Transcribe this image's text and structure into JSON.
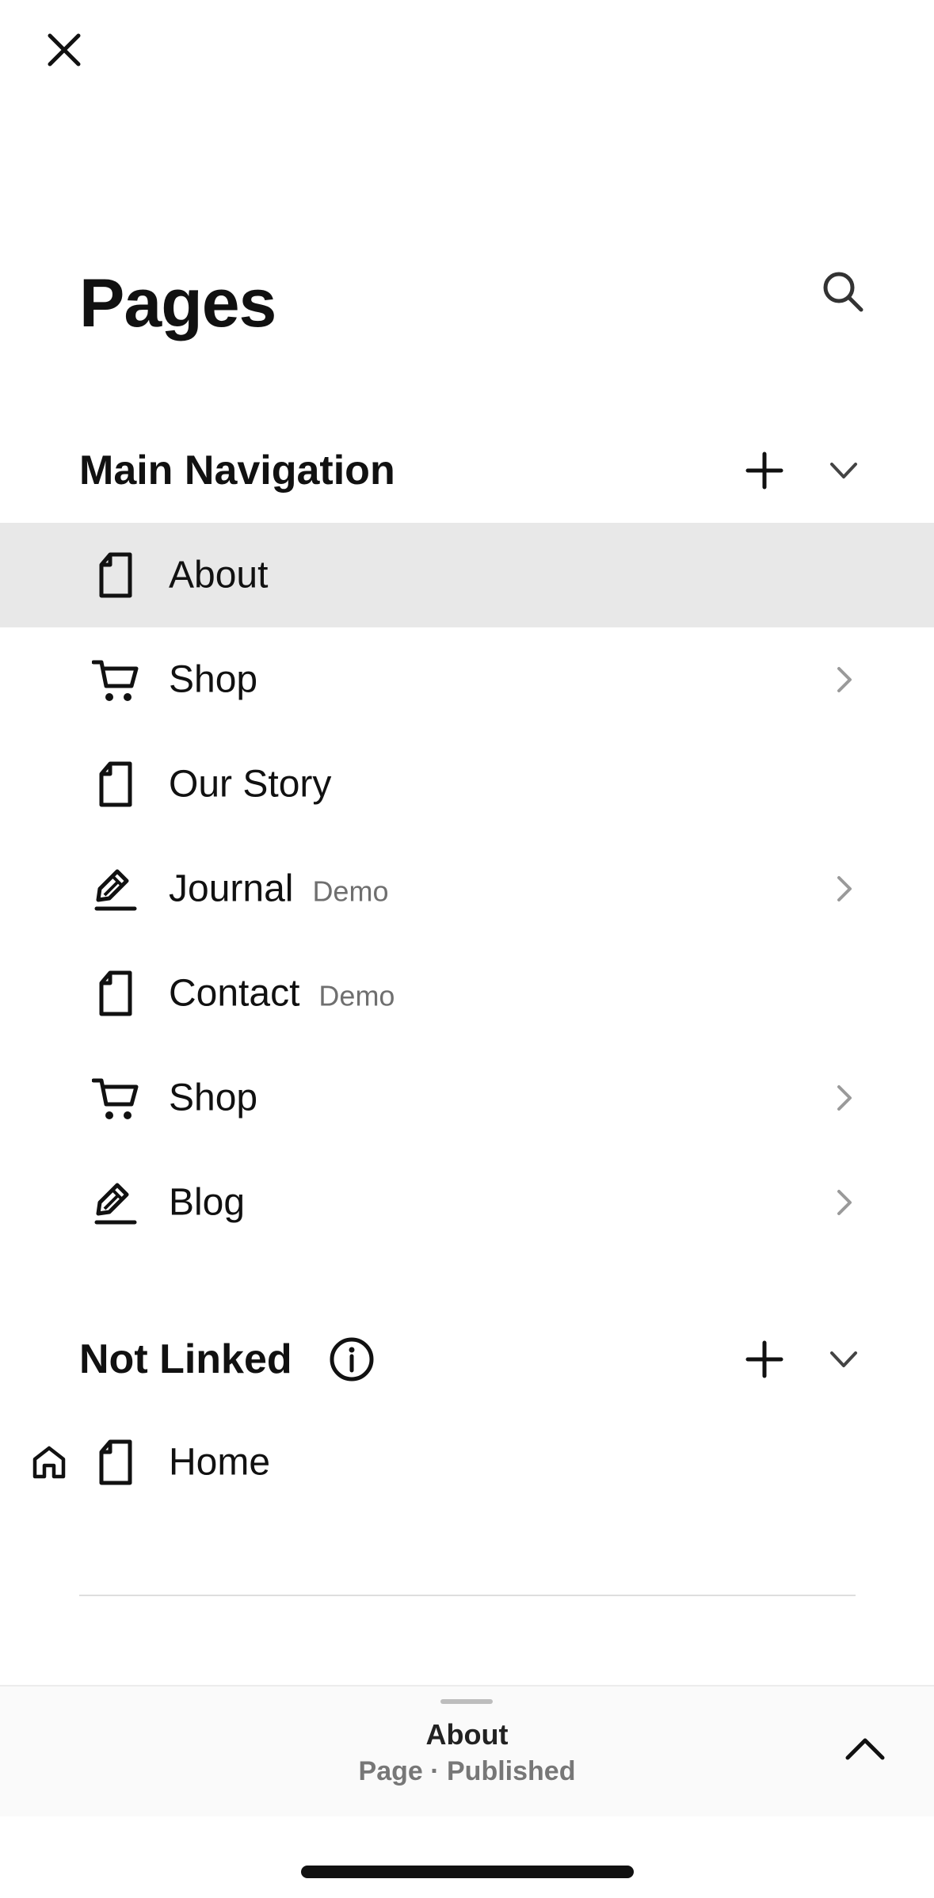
{
  "header": {
    "title": "Pages"
  },
  "sections": {
    "main": {
      "title": "Main Navigation",
      "items": [
        {
          "label": "About",
          "icon": "page-icon",
          "tag": "",
          "selected": true
        },
        {
          "label": "Shop",
          "icon": "cart-icon",
          "tag": "",
          "has_children": true
        },
        {
          "label": "Our Story",
          "icon": "page-icon",
          "tag": ""
        },
        {
          "label": "Journal",
          "icon": "blog-icon",
          "tag": "Demo",
          "has_children": true
        },
        {
          "label": "Contact",
          "icon": "page-icon",
          "tag": "Demo"
        },
        {
          "label": "Shop",
          "icon": "cart-icon",
          "tag": "",
          "has_children": true
        },
        {
          "label": "Blog",
          "icon": "blog-icon",
          "tag": "",
          "has_children": true
        }
      ]
    },
    "not_linked": {
      "title": "Not Linked",
      "items": [
        {
          "label": "Home",
          "icon": "page-icon",
          "tag": "",
          "is_homepage": true
        }
      ]
    }
  },
  "bottom_panel": {
    "title": "About",
    "subtitle": "Page · Published"
  },
  "colors": {
    "selected_row": "#e8e8e8",
    "text": "#111111",
    "muted": "#6f6f6f",
    "chevron": "#9a9a9a"
  }
}
